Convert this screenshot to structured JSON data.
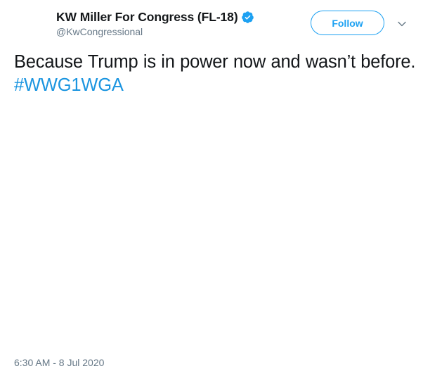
{
  "author": {
    "display_name": "KW Miller For Congress (FL-18)",
    "handle": "@KwCongressional",
    "verified_icon": "verified-badge-icon"
  },
  "actions": {
    "follow_label": "Follow",
    "menu_icon": "chevron-down-icon"
  },
  "tweet": {
    "text": "Because Trump is in power now and wasn’t before.",
    "hashtag": "#WWG1WGA"
  },
  "meta": {
    "timestamp": "6:30 AM - 8 Jul 2020"
  },
  "colors": {
    "brand_blue": "#1da1f2",
    "hashtag_blue": "#1b95e0",
    "secondary_text": "#657786",
    "primary_text": "#14171a"
  }
}
